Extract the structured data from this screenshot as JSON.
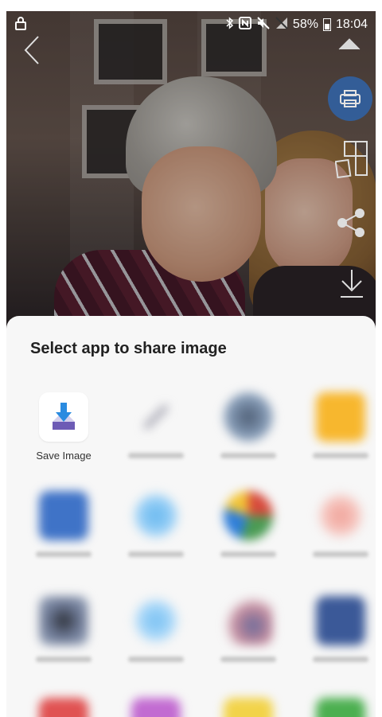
{
  "status_bar": {
    "battery": "58%",
    "time": "18:04"
  },
  "share_sheet": {
    "title": "Select app to share image",
    "apps": [
      {
        "label": "Save Image",
        "blurred": false,
        "icon": "download-to-tray-icon"
      },
      {
        "label": "",
        "blurred": true,
        "color": "#bdbdc7"
      },
      {
        "label": "",
        "blurred": true,
        "color": "#7a8fa8"
      },
      {
        "label": "",
        "blurred": true,
        "color": "#f7b72e"
      },
      {
        "label": "",
        "blurred": true,
        "color": "#3f73c7"
      },
      {
        "label": "",
        "blurred": true,
        "color": "#67b8ef"
      },
      {
        "label": "",
        "blurred": true,
        "color": "#4b9b54"
      },
      {
        "label": "",
        "blurred": true,
        "color": "#f1a39a"
      },
      {
        "label": "",
        "blurred": true,
        "color": "#6a7692"
      },
      {
        "label": "",
        "blurred": true,
        "color": "#79c1f3"
      },
      {
        "label": "",
        "blurred": true,
        "color": "#c38a9c"
      },
      {
        "label": "",
        "blurred": true,
        "color": "#3b5998"
      }
    ]
  },
  "colors": {
    "print_button": "#2f63a8",
    "sheet_bg": "#f7f7f7"
  }
}
